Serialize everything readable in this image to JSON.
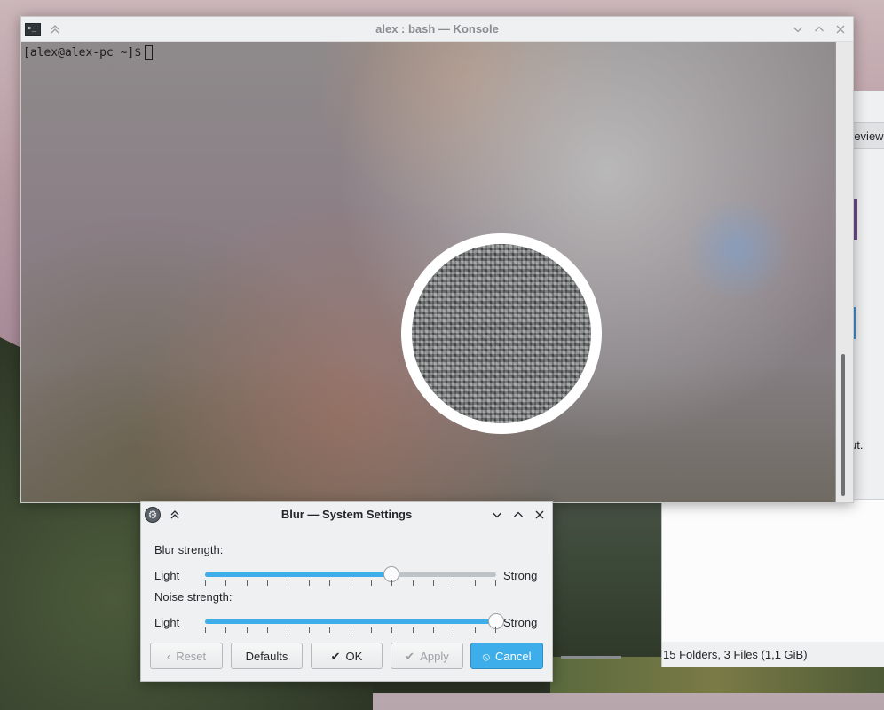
{
  "konsole": {
    "title": "alex : bash — Konsole",
    "prompt": "[alex@alex-pc ~]$"
  },
  "dolphin": {
    "partial_tab": "review",
    "partial_text": "ut.",
    "status": "15 Folders, 3 Files (1,1 GiB)"
  },
  "dialog": {
    "title": "Blur — System Settings",
    "blur": {
      "label": "Blur strength:",
      "min_label": "Light",
      "max_label": "Strong",
      "value": 0.64,
      "ticks": 15
    },
    "noise": {
      "label": "Noise strength:",
      "min_label": "Light",
      "max_label": "Strong",
      "value": 1.0,
      "ticks": 15
    },
    "buttons": {
      "reset": "Reset",
      "defaults": "Defaults",
      "ok": "OK",
      "apply": "Apply",
      "cancel": "Cancel"
    }
  },
  "colors": {
    "accent": "#3daee9",
    "window_bg": "#eff0f1"
  },
  "icons": {
    "konsole": "terminal-icon",
    "settings": "settings-icon",
    "keep_above": "keep-above-icon",
    "minimize": "minimize-icon",
    "maximize": "maximize-icon",
    "close": "close-icon"
  }
}
